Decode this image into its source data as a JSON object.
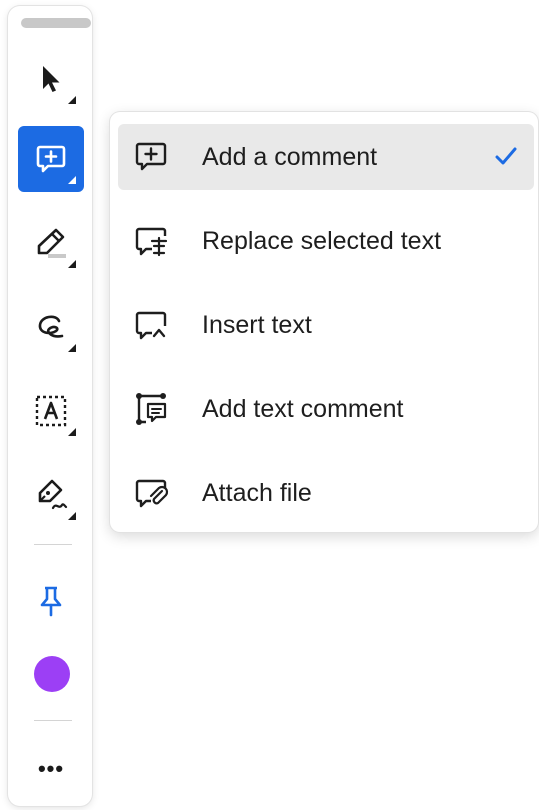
{
  "toolbar": {
    "tools": [
      {
        "name": "select-tool",
        "icon": "arrow-pointer-icon"
      },
      {
        "name": "add-comment-tool",
        "icon": "comment-plus-icon",
        "active": true
      },
      {
        "name": "highlight-tool",
        "icon": "highlighter-icon"
      },
      {
        "name": "draw-tool",
        "icon": "freehand-icon"
      },
      {
        "name": "text-box-tool",
        "icon": "text-box-icon"
      },
      {
        "name": "signature-tool",
        "icon": "pen-sign-icon"
      }
    ],
    "pin_icon": "pin-icon",
    "current_color": "#9c3ff5",
    "more_label": "•••",
    "accent_color": "#1c6be3"
  },
  "menu": {
    "items": [
      {
        "label": "Add a comment",
        "icon": "comment-plus-icon",
        "selected": true
      },
      {
        "label": "Replace selected text",
        "icon": "comment-replace-icon"
      },
      {
        "label": "Insert text",
        "icon": "comment-insert-icon"
      },
      {
        "label": "Add text comment",
        "icon": "text-comment-icon"
      },
      {
        "label": "Attach file",
        "icon": "attach-file-icon"
      }
    ]
  }
}
